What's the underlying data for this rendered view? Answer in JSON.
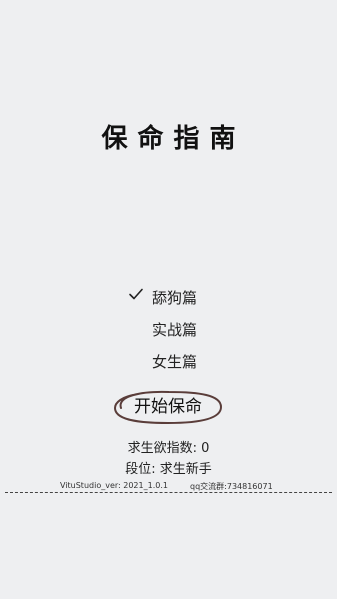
{
  "app": {
    "title": "保命指南"
  },
  "menu": {
    "items": [
      {
        "label": "舔狗篇",
        "selected": true
      },
      {
        "label": "实战篇",
        "selected": false
      },
      {
        "label": "女生篇",
        "selected": false
      }
    ]
  },
  "start_button": {
    "label": "开始保命"
  },
  "stats": {
    "desire_line": "求生欲指数: 0",
    "rank_line": "段位: 求生新手"
  },
  "footer": {
    "version": "VituStudio_ver: 2021_1.0.1",
    "qq_group": "qq交流群:734816071"
  },
  "colors": {
    "background": "#eeeff1",
    "button_outline": "#5a3d3a",
    "text": "#1a1a1a"
  },
  "icons": {
    "selected_marker": "check-icon"
  }
}
